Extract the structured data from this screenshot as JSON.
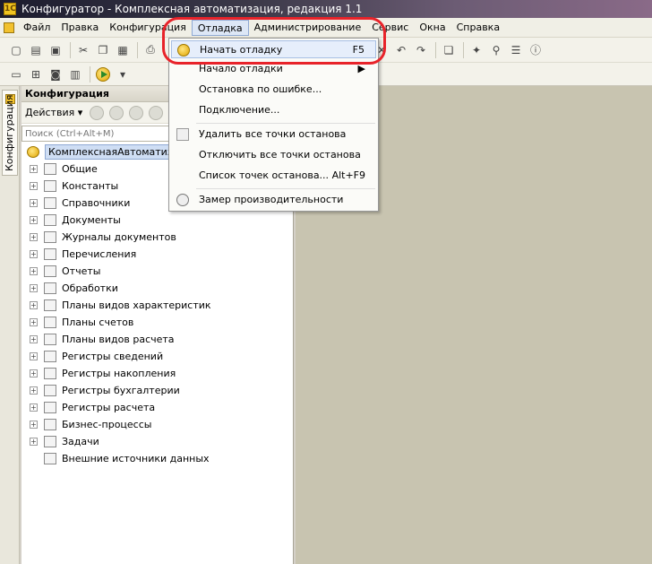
{
  "window": {
    "title": "Конфигуратор - Комплексная автоматизация, редакция 1.1"
  },
  "menubar": {
    "items": [
      "Файл",
      "Правка",
      "Конфигурация",
      "Отладка",
      "Администрирование",
      "Сервис",
      "Окна",
      "Справка"
    ],
    "active": "Отладка"
  },
  "debug_menu": {
    "items": [
      {
        "label": "Начать отладку",
        "shortcut": "F5",
        "highlighted": true
      },
      {
        "label": "Начало отладки",
        "shortcut": "",
        "submenu": true
      },
      {
        "label": "Остановка по ошибке...",
        "shortcut": ""
      },
      {
        "label": "Подключение...",
        "shortcut": ""
      },
      {
        "label": "Удалить все точки останова",
        "shortcut": ""
      },
      {
        "label": "Отключить все точки останова",
        "shortcut": ""
      },
      {
        "label": "Список точек останова...",
        "shortcut": "Alt+F9"
      },
      {
        "label": "Замер производительности",
        "shortcut": ""
      }
    ]
  },
  "side_tab": {
    "label": "Конфигурация"
  },
  "panel": {
    "title": "Конфигурация",
    "actions_label": "Действия",
    "search_placeholder": "Поиск (Ctrl+Alt+M)"
  },
  "tree": {
    "root": "КомплекснаяАвтоматизация",
    "items": [
      "Общие",
      "Константы",
      "Справочники",
      "Документы",
      "Журналы документов",
      "Перечисления",
      "Отчеты",
      "Обработки",
      "Планы видов характеристик",
      "Планы счетов",
      "Планы видов расчета",
      "Регистры сведений",
      "Регистры накопления",
      "Регистры бухгалтерии",
      "Регистры расчета",
      "Бизнес-процессы",
      "Задачи",
      "Внешние источники данных"
    ]
  },
  "colors": {
    "highlight_oval": "#e8232a",
    "menu_highlight": "#e6eefb",
    "workspace": "#c8c4b0"
  }
}
